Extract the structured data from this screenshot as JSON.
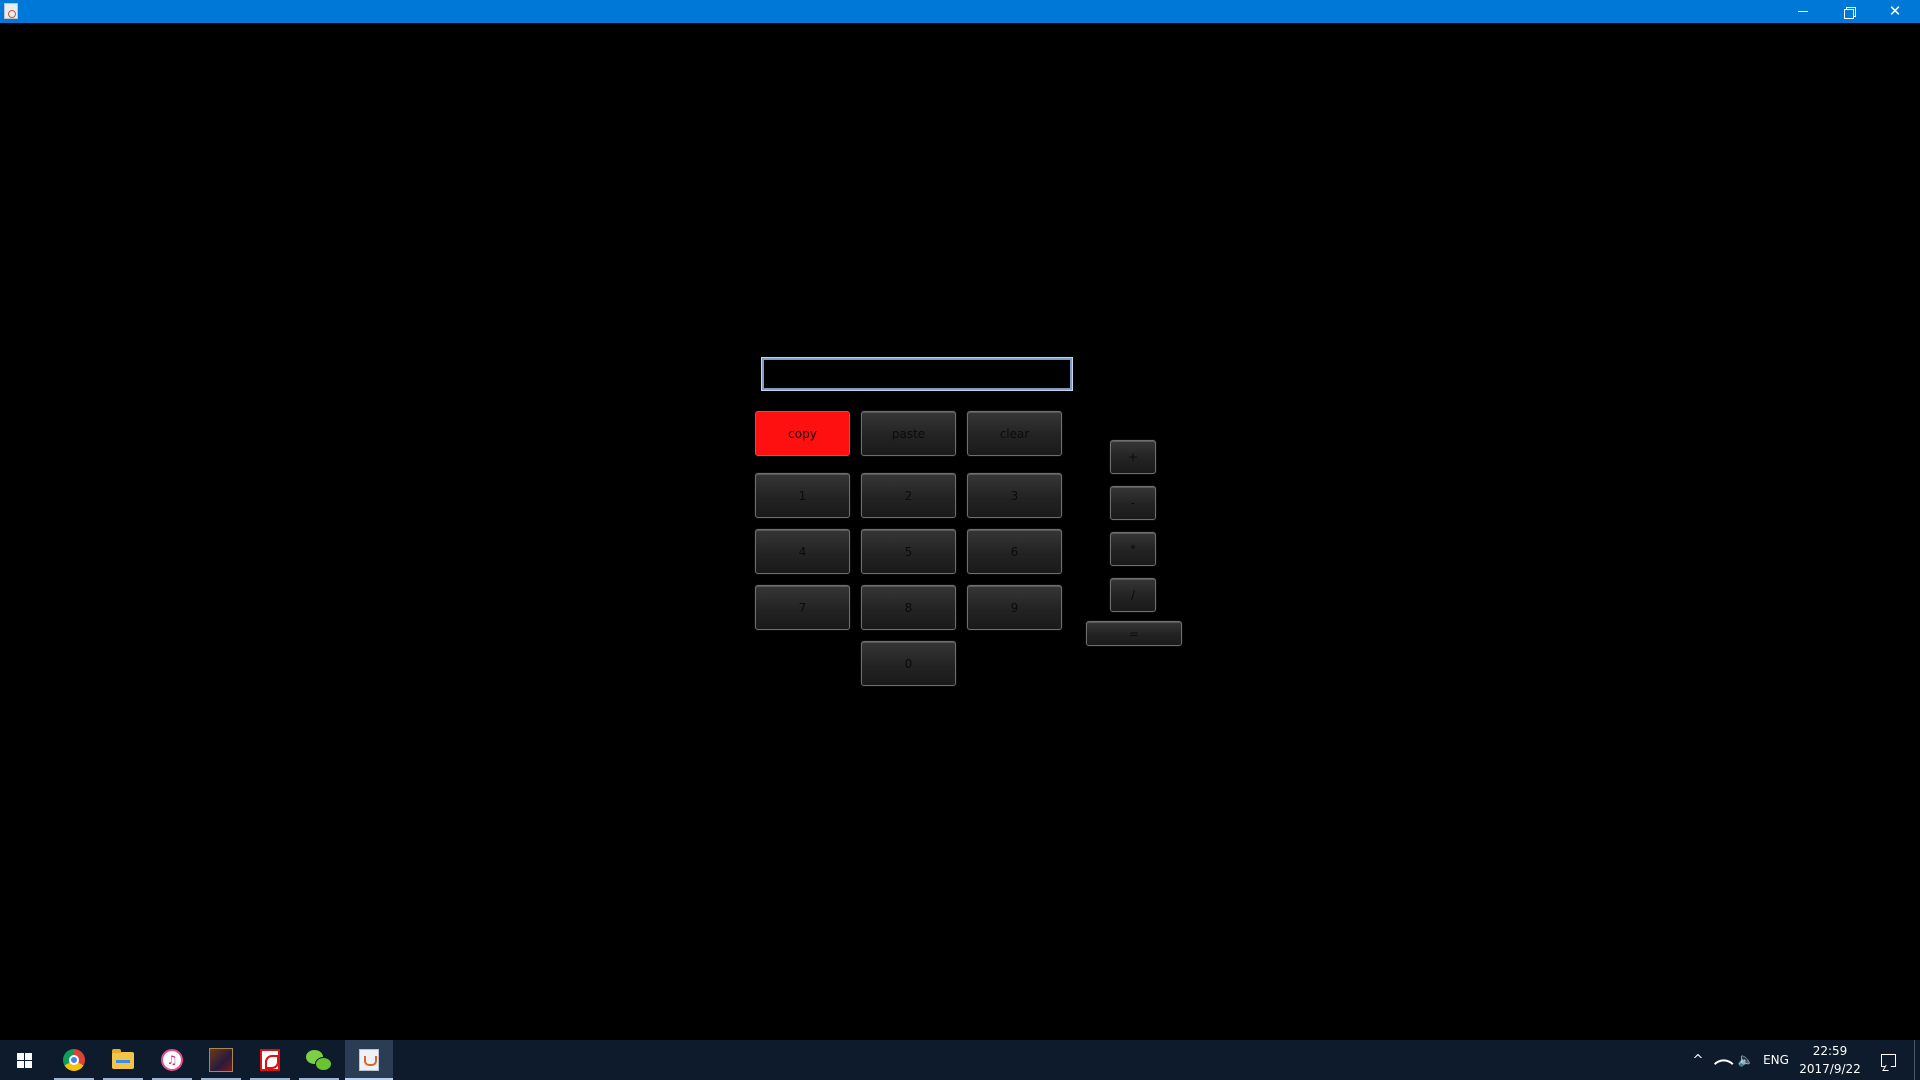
{
  "window": {
    "title": "",
    "controls": {
      "minimize_icon": "minimize-icon",
      "restore_icon": "restore-icon",
      "close_icon": "close-icon",
      "close_glyph": "✕"
    }
  },
  "calculator": {
    "display": {
      "value": ""
    },
    "edit_row": [
      {
        "label": "copy",
        "style": "highlighted-red"
      },
      {
        "label": "paste"
      },
      {
        "label": "clear"
      }
    ],
    "digits": [
      "1",
      "2",
      "3",
      "4",
      "5",
      "6",
      "7",
      "8",
      "9",
      "0"
    ],
    "operators": [
      "+",
      "-",
      "*",
      "/"
    ],
    "equals": "=",
    "colors": {
      "background": "#000000",
      "button": "#2a2a2a",
      "copy_button": "#ff1010",
      "display_border": "#7f9cc2"
    }
  },
  "taskbar": {
    "apps": [
      {
        "name": "start",
        "icon": "windows-logo-icon"
      },
      {
        "name": "chrome",
        "icon": "chrome-icon"
      },
      {
        "name": "file-explorer",
        "icon": "folder-icon"
      },
      {
        "name": "itunes",
        "icon": "itunes-icon",
        "glyph": "♫"
      },
      {
        "name": "game",
        "icon": "game-icon"
      },
      {
        "name": "acrobat",
        "icon": "pdf-icon"
      },
      {
        "name": "wechat",
        "icon": "wechat-icon"
      },
      {
        "name": "java",
        "icon": "java-icon",
        "active": true
      }
    ],
    "tray": {
      "chevron": "^",
      "volume_glyph": "🔈",
      "language": "ENG",
      "time": "22:59",
      "date": "2017/9/22"
    },
    "colors": {
      "taskbar_bg": "#0e1b2c",
      "titlebar_bg": "#0078d7"
    }
  }
}
